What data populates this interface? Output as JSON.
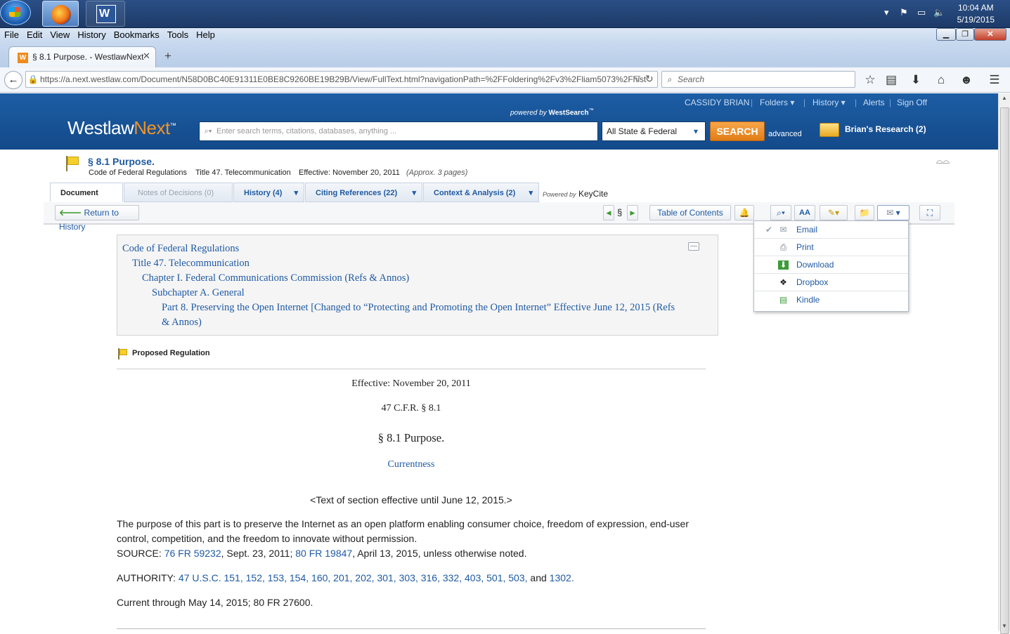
{
  "taskbar": {
    "clock_time": "10:04 AM",
    "clock_date": "5/19/2015",
    "word_label": "W"
  },
  "menu": [
    "File",
    "Edit",
    "View",
    "History",
    "Bookmarks",
    "Tools",
    "Help"
  ],
  "browser": {
    "tab_title": "§ 8.1 Purpose. - WestlawNext",
    "tab_favicon": "W",
    "url": "https://a.next.westlaw.com/Document/N58D0BC40E91311E0BE8C9260BE19B29B/View/FullText.html?navigationPath=%2FFoldering%2Fv3%2Fliam5073%2Fhist",
    "search_placeholder": "Search"
  },
  "westlaw": {
    "logo_a": "Westlaw",
    "logo_b": "Next",
    "powered_by": "powered by",
    "westsearch": "WestSearch",
    "user": "CASSIDY BRIAN",
    "links": [
      "Folders",
      "History",
      "Alerts",
      "Sign Off"
    ],
    "search_placeholder": "Enter search terms, citations, databases, anything ...",
    "jurisdiction": "All State & Federal",
    "search_button": "SEARCH",
    "advanced": "advanced",
    "research_folder": "Brian's Research (2)"
  },
  "document": {
    "title": "§ 8.1 Purpose.",
    "meta_source": "Code of Federal Regulations",
    "meta_title": "Title 47. Telecommunication",
    "meta_effective": "Effective: November 20, 2011",
    "meta_pages": "(Approx. 3 pages)",
    "tabs": {
      "document": "Document",
      "notes": "Notes of Decisions (0)",
      "history": "History (4)",
      "citing": "Citing References (22)",
      "context": "Context & Analysis (2)"
    },
    "keycite_powered": "Powered by",
    "keycite": "KeyCite",
    "return_history": "Return to History",
    "section_symbol": "§",
    "toc_button": "Table of Contents",
    "font_button": "AA",
    "toc_lines": [
      "Code of Federal Regulations",
      "Title 47. Telecommunication",
      "Chapter I. Federal Communications Commission (Refs & Annos)",
      "Subchapter A. General",
      "Part 8. Preserving the Open Internet [Changed to “Protecting and Promoting the Open Internet” Effective June 12, 2015 (Refs",
      "& Annos)"
    ],
    "proposed_regulation": "Proposed Regulation",
    "effective_line": "Effective: November 20, 2011",
    "cfr_cite": "47 C.F.R. § 8.1",
    "section_heading": "§ 8.1 Purpose.",
    "currentness": "Currentness",
    "effective_note": "<Text of section effective until June 12, 2015.>",
    "purpose_line1": "The purpose of this part is to preserve the Internet as an open platform enabling consumer choice, freedom of expression, end-user",
    "purpose_line2": "control, competition, and the freedom to innovate without permission.",
    "source_label": "SOURCE: ",
    "source_link1": "76 FR 59232",
    "source_mid": ", Sept. 23, 2011; ",
    "source_link2": "80 FR 19847",
    "source_end": ", April 13, 2015, unless otherwise noted.",
    "authority_label": "AUTHORITY: ",
    "authority_links": "47 U.S.C. 151, 152, 153, 154, 160, 201, 202, 301, 303, 316, 332, 403, 501, 503,",
    "authority_and": " and ",
    "authority_last": "1302",
    "authority_end": ".",
    "current_through": "Current through May 14, 2015; 80 FR 27600."
  },
  "share_menu": {
    "items": [
      {
        "label": "Email",
        "icon": "envelope-icon"
      },
      {
        "label": "Print",
        "icon": "printer-icon"
      },
      {
        "label": "Download",
        "icon": "download-icon"
      },
      {
        "label": "Dropbox",
        "icon": "dropbox-icon"
      },
      {
        "label": "Kindle",
        "icon": "kindle-icon"
      }
    ]
  },
  "colors": {
    "westlaw_blue": "#1c5da4",
    "link_blue": "#1f5aa3",
    "search_orange": "#f29326"
  }
}
